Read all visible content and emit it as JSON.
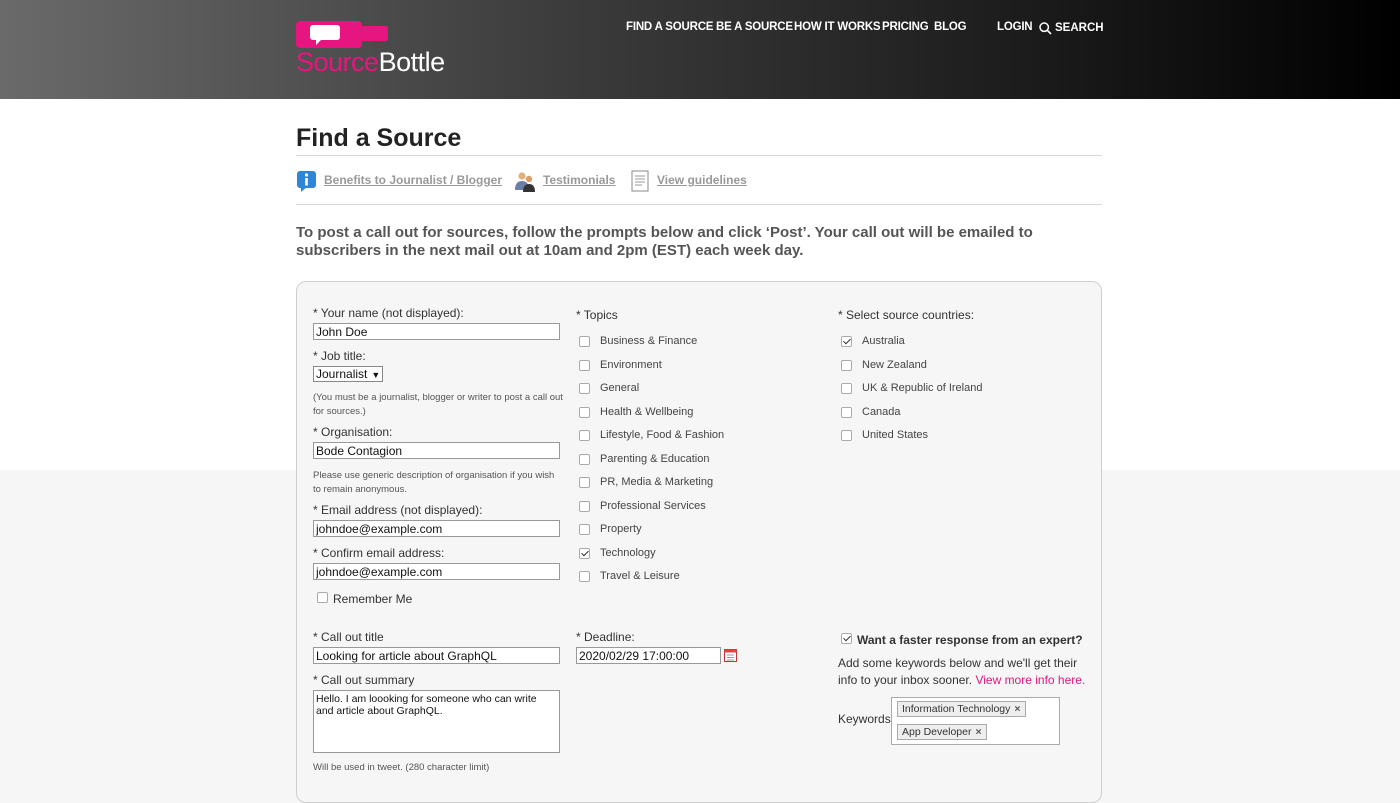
{
  "header": {
    "logo": {
      "part1": "Source",
      "part2": "Bottle"
    },
    "nav": [
      "FIND A SOURCE",
      "BE A SOURCE",
      "HOW IT WORKS",
      "PRICING",
      "BLOG"
    ],
    "login": "LOGIN",
    "search": "SEARCH"
  },
  "page": {
    "title": "Find a Source",
    "links": [
      {
        "label": "Benefits to Journalist / Blogger",
        "icon": "info-icon"
      },
      {
        "label": "Testimonials",
        "icon": "people-icon"
      },
      {
        "label": "View guidelines",
        "icon": "document-icon"
      }
    ],
    "intro": "To post a call out for sources, follow the prompts below and click ‘Post’. Your call out will be emailed to subscribers in the next mail out at 10am and 2pm (EST) each week day."
  },
  "form": {
    "name_label": "* Your name (not displayed):",
    "name_value": "John Doe",
    "job_label": "* Job title:",
    "job_value": "Journalist",
    "job_note": "(You must be a journalist, blogger or writer to post a call out for sources.)",
    "org_label": "* Organisation:",
    "org_value": "Bode Contagion",
    "org_note": "Please use generic description of organisation if you wish to remain anonymous.",
    "email_label": "* Email address (not displayed):",
    "email_value": "johndoe@example.com",
    "confirm_label": "* Confirm email address:",
    "confirm_value": "johndoe@example.com",
    "remember_label": "Remember Me",
    "remember_checked": false,
    "topics_label": "* Topics",
    "topics": [
      {
        "label": "Business & Finance",
        "checked": false
      },
      {
        "label": "Environment",
        "checked": false
      },
      {
        "label": "General",
        "checked": false
      },
      {
        "label": "Health & Wellbeing",
        "checked": false
      },
      {
        "label": "Lifestyle, Food & Fashion",
        "checked": false
      },
      {
        "label": "Parenting & Education",
        "checked": false
      },
      {
        "label": "PR, Media & Marketing",
        "checked": false
      },
      {
        "label": "Professional Services",
        "checked": false
      },
      {
        "label": "Property",
        "checked": false
      },
      {
        "label": "Technology",
        "checked": true
      },
      {
        "label": "Travel & Leisure",
        "checked": false
      }
    ],
    "countries_label": "* Select source countries:",
    "countries": [
      {
        "label": "Australia",
        "checked": true
      },
      {
        "label": "New Zealand",
        "checked": false
      },
      {
        "label": "UK & Republic of Ireland",
        "checked": false
      },
      {
        "label": "Canada",
        "checked": false
      },
      {
        "label": "United States",
        "checked": false
      }
    ],
    "callout_title_label": "* Call out title",
    "callout_title_value": "Looking for article about GraphQL",
    "summary_label": "* Call out summary",
    "summary_value": "Hello. I am loooking for someone who can write and article about GraphQL.",
    "summary_note": "Will be used in tweet. (280 character limit)",
    "deadline_label": "* Deadline:",
    "deadline_value": "2020/02/29 17:00:00",
    "expert_label": "Want a faster response from an expert?",
    "expert_checked": true,
    "expert_text": "Add some keywords below and we'll get their info to your inbox sooner.",
    "expert_link": "View more info here.",
    "keywords_label": "Keywords:",
    "keywords": [
      "Information Technology",
      "App Developer"
    ]
  },
  "colors": {
    "brand": "#e6157f",
    "header_dark": "#000000"
  }
}
